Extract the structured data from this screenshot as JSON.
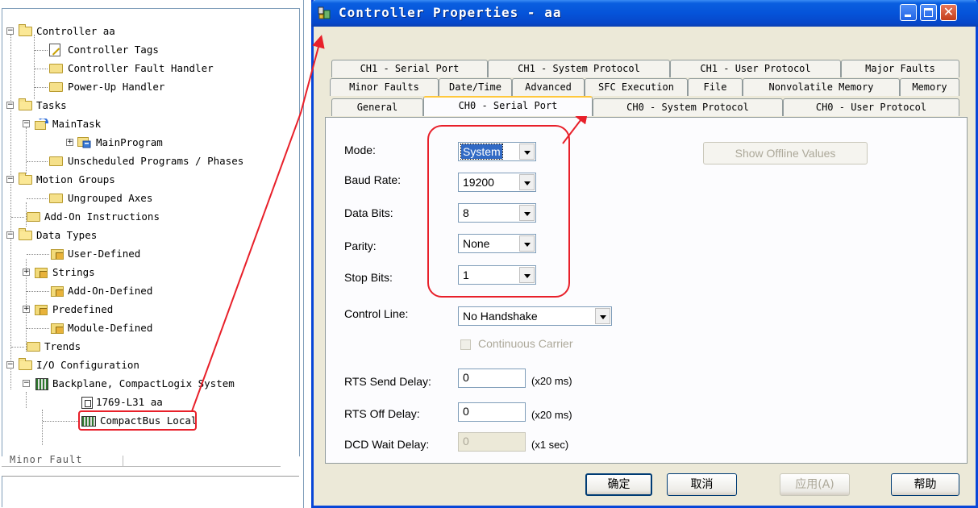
{
  "tree": {
    "items": [
      {
        "label": "Controller aa"
      },
      {
        "label": "Controller Tags"
      },
      {
        "label": "Controller Fault Handler"
      },
      {
        "label": "Power-Up Handler"
      },
      {
        "label": "Tasks"
      },
      {
        "label": "MainTask"
      },
      {
        "label": "MainProgram"
      },
      {
        "label": "Unscheduled Programs / Phases"
      },
      {
        "label": "Motion Groups"
      },
      {
        "label": "Ungrouped Axes"
      },
      {
        "label": "Add-On Instructions"
      },
      {
        "label": "Data Types"
      },
      {
        "label": "User-Defined"
      },
      {
        "label": "Strings"
      },
      {
        "label": "Add-On-Defined"
      },
      {
        "label": "Predefined"
      },
      {
        "label": "Module-Defined"
      },
      {
        "label": "Trends"
      },
      {
        "label": "I/O Configuration"
      },
      {
        "label": "Backplane, CompactLogix System"
      },
      {
        "label": "1769-L31 aa"
      },
      {
        "label": "CompactBus Local"
      }
    ],
    "status_text": "Minor Fault"
  },
  "dialog": {
    "title": "Controller Properties - aa",
    "tabs_row1": [
      "CH1 - Serial Port",
      "CH1 - System Protocol",
      "CH1 - User Protocol",
      "Major Faults"
    ],
    "tabs_row2": [
      "Minor Faults",
      "Date/Time",
      "Advanced",
      "SFC Execution",
      "File",
      "Nonvolatile Memory",
      "Memory"
    ],
    "tabs_row3": [
      "General",
      "CH0 - Serial Port",
      "CH0 - System Protocol",
      "CH0 - User Protocol"
    ],
    "active_tab": "CH0 - Serial Port",
    "form": {
      "mode_label": "Mode:",
      "mode_value": "System",
      "baud_label": "Baud Rate:",
      "baud_value": "19200",
      "databits_label": "Data Bits:",
      "databits_value": "8",
      "parity_label": "Parity:",
      "parity_value": "None",
      "stopbits_label": "Stop Bits:",
      "stopbits_value": "1",
      "control_label": "Control Line:",
      "control_value": "No Handshake",
      "cc_label": "Continuous Carrier",
      "rts_send_label": "RTS Send Delay:",
      "rts_send_value": "0",
      "rts_send_units": "(x20 ms)",
      "rts_off_label": "RTS Off Delay:",
      "rts_off_value": "0",
      "rts_off_units": "(x20 ms)",
      "dcd_label": "DCD Wait Delay:",
      "dcd_value": "0",
      "dcd_units": "(x1 sec)",
      "show_offline_label": "Show Offline Values"
    },
    "buttons": {
      "ok": "确定",
      "cancel": "取消",
      "apply": "应用(A)",
      "help": "帮助"
    }
  },
  "colors": {
    "annotation": "#e8202a",
    "titlebar": "#0553d9"
  }
}
